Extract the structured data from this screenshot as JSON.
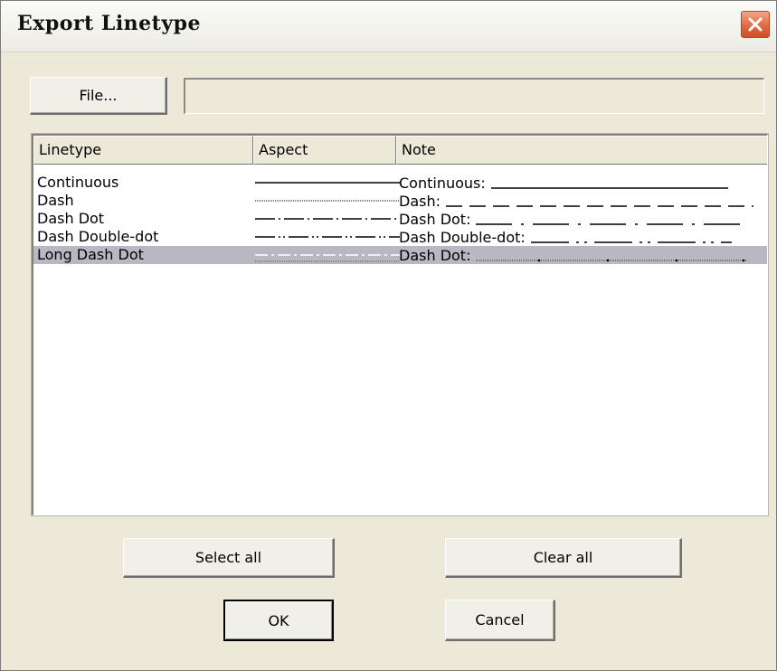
{
  "window": {
    "title": "Export Linetype",
    "close_icon": "close-icon"
  },
  "file": {
    "button_label": "File...",
    "path_value": ""
  },
  "list": {
    "columns": [
      "Linetype",
      "Aspect",
      "Note"
    ],
    "rows": [
      {
        "linetype": "Continuous",
        "aspect": "continuous",
        "note": "Continuous:",
        "selected": false
      },
      {
        "linetype": "Dash",
        "aspect": "dash",
        "note": "Dash:",
        "selected": false
      },
      {
        "linetype": "Dash Dot",
        "aspect": "dash-dot",
        "note": "Dash Dot:",
        "selected": false
      },
      {
        "linetype": "Dash Double-dot",
        "aspect": "dash-double-dot",
        "note": "Dash Double-dot:",
        "selected": false
      },
      {
        "linetype": "Long Dash Dot",
        "aspect": "long-dash-dot",
        "note": "Dash Dot:",
        "selected": true
      }
    ]
  },
  "buttons": {
    "select_all": "Select all",
    "clear_all": "Clear all",
    "ok": "OK",
    "cancel": "Cancel"
  },
  "colors": {
    "dialog_bg": "#ece9d8",
    "selection": "#b8b7c2",
    "close_button": "#e06a43"
  }
}
